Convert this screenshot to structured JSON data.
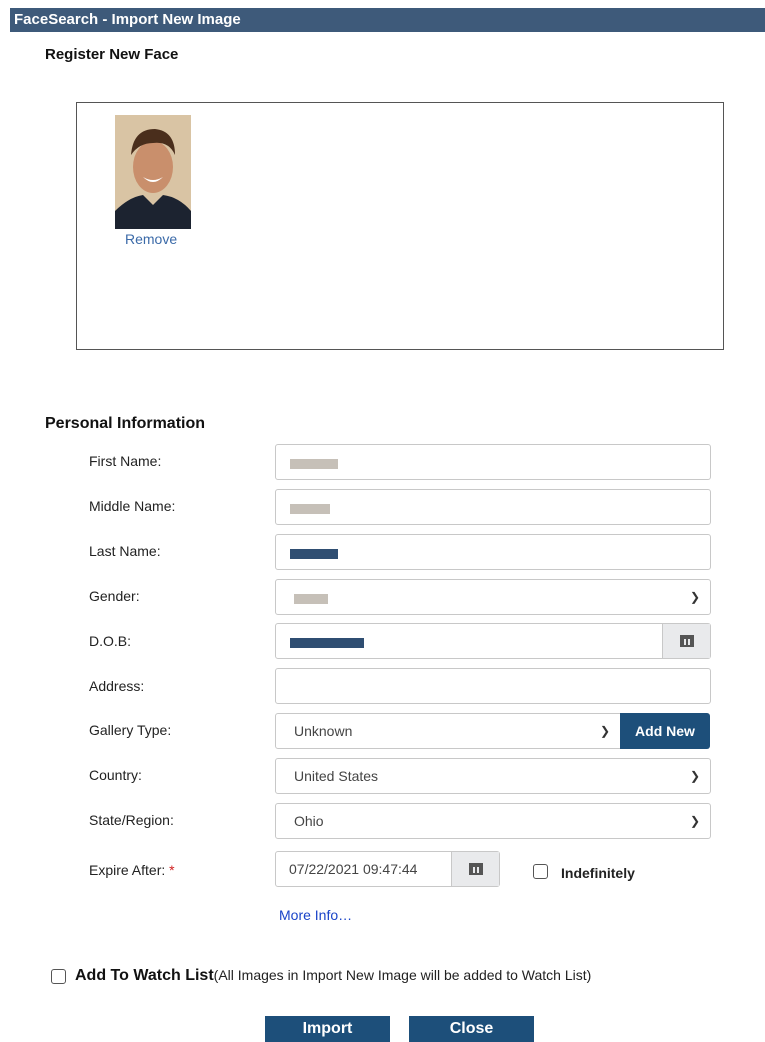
{
  "window": {
    "title": "FaceSearch - Import New Image"
  },
  "register": {
    "heading": "Register New Face",
    "remove_label": "Remove"
  },
  "personal": {
    "heading": "Personal Information",
    "fields": {
      "first_name": {
        "label": "First Name:"
      },
      "middle_name": {
        "label": "Middle Name:"
      },
      "last_name": {
        "label": "Last Name:"
      },
      "gender": {
        "label": "Gender:"
      },
      "dob": {
        "label": "D.O.B:"
      },
      "address": {
        "label": "Address:",
        "value": ""
      },
      "gallery_type": {
        "label": "Gallery Type:",
        "value": "Unknown",
        "add_new_label": "Add New"
      },
      "country": {
        "label": "Country:",
        "value": "United States"
      },
      "state": {
        "label": "State/Region:",
        "value": "Ohio"
      },
      "expire": {
        "label": "Expire After:",
        "required_mark": "*",
        "value": "07/22/2021 09:47:44",
        "indefinitely_label": "Indefinitely"
      }
    },
    "more_info": "More Info…"
  },
  "watch_list": {
    "label": "Add To Watch List",
    "note": "(All Images in Import New Image will be added to Watch List)"
  },
  "actions": {
    "import_label": "Import",
    "close_label": "Close"
  },
  "colors": {
    "title_bar": "#3e5a7a",
    "button": "#1d4f7a",
    "link": "#3b6aa8",
    "redact_blue": "#2f4e72",
    "redact_gray": "#c6c0b8"
  }
}
